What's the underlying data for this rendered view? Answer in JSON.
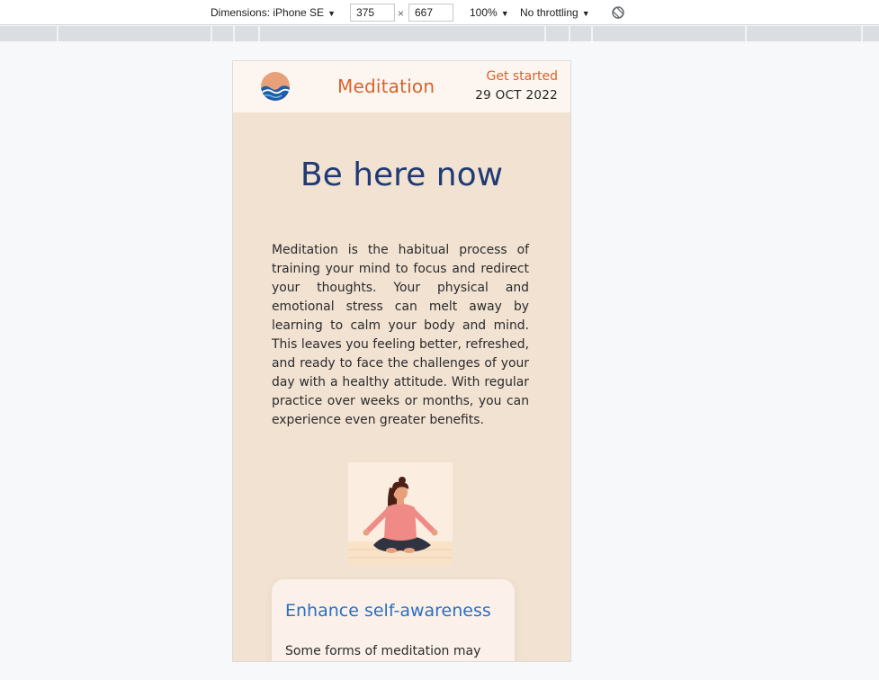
{
  "devtools": {
    "device_label": "Dimensions: iPhone SE",
    "width_value": "375",
    "times_sign": "×",
    "height_value": "667",
    "zoom_label": "100%",
    "throttle_label": "No throttling",
    "caret": "▼",
    "icons": {
      "rotate": "rotate-icon"
    }
  },
  "header": {
    "logo": "wave-sun-logo-icon",
    "brand": "Meditation",
    "cta": "Get started",
    "date": "29 OCT 2022"
  },
  "hero": {
    "title": "Be here now",
    "intro": "Meditation is the habitual process of training your mind to focus and redirect your thoughts. Your physical and emotional stress can melt away by learning to calm your body and mind. This leaves you feeling better, refreshed, and ready to face the challenges of your day with a healthy attitude. With regular practice over weeks or months, you can experience even greater benefits.",
    "illustration": "meditating-woman-illustration"
  },
  "card": {
    "title": "Enhance self-awareness",
    "body": "Some forms of meditation may"
  },
  "colors": {
    "accent": "#d9622b",
    "title_blue": "#1f3a75",
    "card_title_blue": "#2a6fc1",
    "page_bg": "#f1e2d2",
    "header_bg": "#fdf6f0"
  }
}
